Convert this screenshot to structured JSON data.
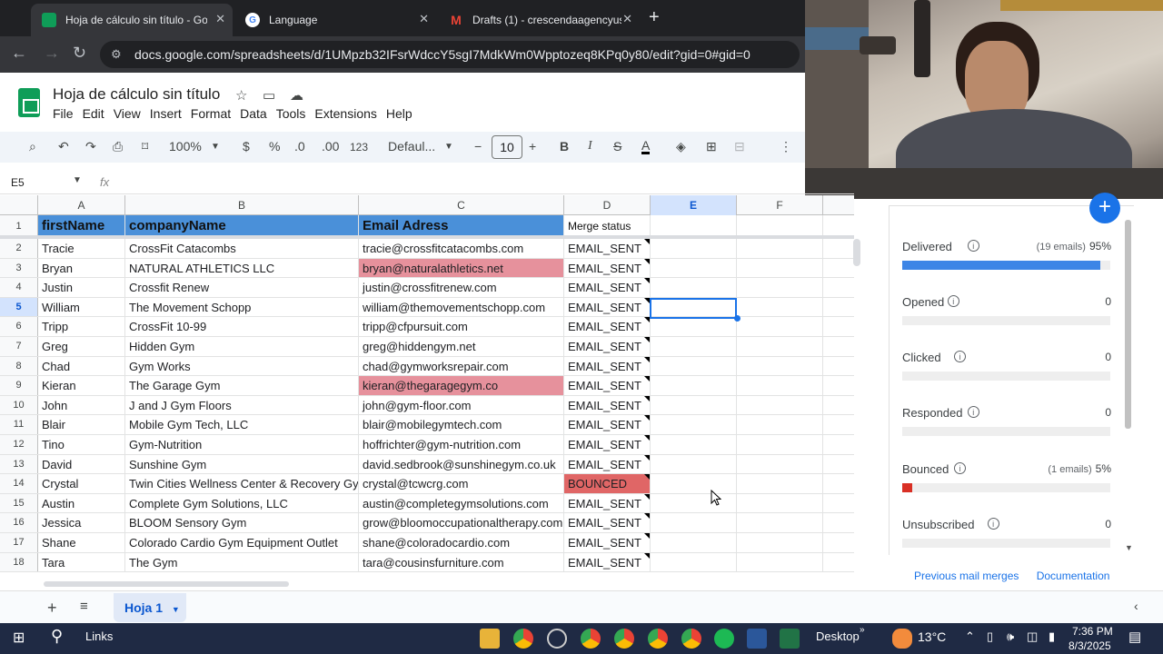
{
  "browser": {
    "tabs": [
      {
        "title": "Hoja de cálculo sin título - Goo",
        "active": true,
        "favicon_color": "#0f9d58"
      },
      {
        "title": "Language",
        "active": false,
        "favicon_color": "#4285f4"
      },
      {
        "title": "Drafts (1) - crescendaagencyus",
        "active": false,
        "favicon_color": "#ea4335"
      }
    ],
    "url": "docs.google.com/spreadsheets/d/1UMpzb32IFsrWdccY5sgI7MdkWm0Wpptozeq8KPq0y80/edit?gid=0#gid=0"
  },
  "doc": {
    "title": "Hoja de cálculo sin título",
    "menu": [
      "File",
      "Edit",
      "View",
      "Insert",
      "Format",
      "Data",
      "Tools",
      "Extensions",
      "Help"
    ]
  },
  "toolbar": {
    "zoom": "100%",
    "currency": "$",
    "percent": "%",
    "dec_decrease": ".0",
    "dec_increase": ".00",
    "number_format": "123",
    "font": "Defaul...",
    "font_size": "10",
    "bold": "B",
    "italic": "I",
    "text_color": "A"
  },
  "formula_bar": {
    "cell_ref": "E5",
    "fx": "fx"
  },
  "grid": {
    "columns": [
      "A",
      "B",
      "C",
      "D",
      "E",
      "F"
    ],
    "selected_cell": "E5",
    "header_row": {
      "first_name": "firstName",
      "company": "companyName",
      "email": "Email Adress",
      "status": "Merge status"
    },
    "rows": [
      {
        "n": "2",
        "first": "Tracie",
        "company": "CrossFit Catacombs",
        "email": "tracie@crossfitcatacombs.com",
        "status": "EMAIL_SENT",
        "email_highlight": false,
        "bounced": false
      },
      {
        "n": "3",
        "first": "Bryan",
        "company": "NATURAL ATHLETICS LLC",
        "email": "bryan@naturalathletics.net",
        "status": "EMAIL_SENT",
        "email_highlight": true,
        "bounced": false
      },
      {
        "n": "4",
        "first": "Justin",
        "company": "Crossfit Renew",
        "email": "justin@crossfitrenew.com",
        "status": "EMAIL_SENT",
        "email_highlight": false,
        "bounced": false
      },
      {
        "n": "5",
        "first": "William",
        "company": "The Movement Schopp",
        "email": "william@themovementschopp.com",
        "status": "EMAIL_SENT",
        "email_highlight": false,
        "bounced": false
      },
      {
        "n": "6",
        "first": "Tripp",
        "company": "CrossFit 10-99",
        "email": "tripp@cfpursuit.com",
        "status": "EMAIL_SENT",
        "email_highlight": false,
        "bounced": false
      },
      {
        "n": "7",
        "first": "Greg",
        "company": "Hidden Gym",
        "email": "greg@hiddengym.net",
        "status": "EMAIL_SENT",
        "email_highlight": false,
        "bounced": false
      },
      {
        "n": "8",
        "first": "Chad",
        "company": "Gym Works",
        "email": "chad@gymworksrepair.com",
        "status": "EMAIL_SENT",
        "email_highlight": false,
        "bounced": false
      },
      {
        "n": "9",
        "first": "Kieran",
        "company": "The Garage Gym",
        "email": "kieran@thegaragegym.co",
        "status": "EMAIL_SENT",
        "email_highlight": true,
        "bounced": false
      },
      {
        "n": "10",
        "first": "John",
        "company": "J and J Gym Floors",
        "email": "john@gym-floor.com",
        "status": "EMAIL_SENT",
        "email_highlight": false,
        "bounced": false
      },
      {
        "n": "11",
        "first": "Blair",
        "company": "Mobile Gym Tech, LLC",
        "email": "blair@mobilegymtech.com",
        "status": "EMAIL_SENT",
        "email_highlight": false,
        "bounced": false
      },
      {
        "n": "12",
        "first": "Tino",
        "company": "Gym-Nutrition",
        "email": "hoffrichter@gym-nutrition.com",
        "status": "EMAIL_SENT",
        "email_highlight": false,
        "bounced": false
      },
      {
        "n": "13",
        "first": "David",
        "company": "Sunshine Gym",
        "email": "david.sedbrook@sunshinegym.co.uk",
        "status": "EMAIL_SENT",
        "email_highlight": false,
        "bounced": false
      },
      {
        "n": "14",
        "first": "Crystal",
        "company": "Twin Cities Wellness Center & Recovery Gym",
        "email": "crystal@tcwcrg.com",
        "status": "BOUNCED",
        "email_highlight": false,
        "bounced": true
      },
      {
        "n": "15",
        "first": "Austin",
        "company": "Complete Gym Solutions, LLC",
        "email": "austin@completegymsolutions.com",
        "status": "EMAIL_SENT",
        "email_highlight": false,
        "bounced": false
      },
      {
        "n": "16",
        "first": "Jessica",
        "company": "BLOOM Sensory Gym",
        "email": "grow@bloomoccupationaltherapy.com",
        "status": "EMAIL_SENT",
        "email_highlight": false,
        "bounced": false
      },
      {
        "n": "17",
        "first": "Shane",
        "company": "Colorado Cardio Gym Equipment Outlet",
        "email": "shane@coloradocardio.com",
        "status": "EMAIL_SENT",
        "email_highlight": false,
        "bounced": false
      },
      {
        "n": "18",
        "first": "Tara",
        "company": "The Gym",
        "email": "tara@cousinsfurniture.com",
        "status": "EMAIL_SENT",
        "email_highlight": false,
        "bounced": false
      }
    ]
  },
  "panel": {
    "metrics": [
      {
        "label": "Delivered",
        "count": "(19 emails)",
        "value": "95%",
        "fill": 0.95,
        "color": "#3d85e6"
      },
      {
        "label": "Opened",
        "count": "",
        "value": "0",
        "fill": 0,
        "color": "#3d85e6"
      },
      {
        "label": "Clicked",
        "count": "",
        "value": "0",
        "fill": 0,
        "color": "#3d85e6"
      },
      {
        "label": "Responded",
        "count": "",
        "value": "0",
        "fill": 0,
        "color": "#3d85e6"
      },
      {
        "label": "Bounced",
        "count": "(1 emails)",
        "value": "5%",
        "fill": 0.05,
        "color": "#d93025"
      },
      {
        "label": "Unsubscribed",
        "count": "",
        "value": "0",
        "fill": 0,
        "color": "#3d85e6"
      }
    ],
    "footer": {
      "previous": "Previous mail merges",
      "docs": "Documentation"
    }
  },
  "sheet_tabs": {
    "active": "Hoja 1"
  },
  "taskbar": {
    "links_label": "Links",
    "desktop_label": "Desktop",
    "temperature": "13°C",
    "time": "7:36 PM",
    "date": "8/3/2025"
  }
}
